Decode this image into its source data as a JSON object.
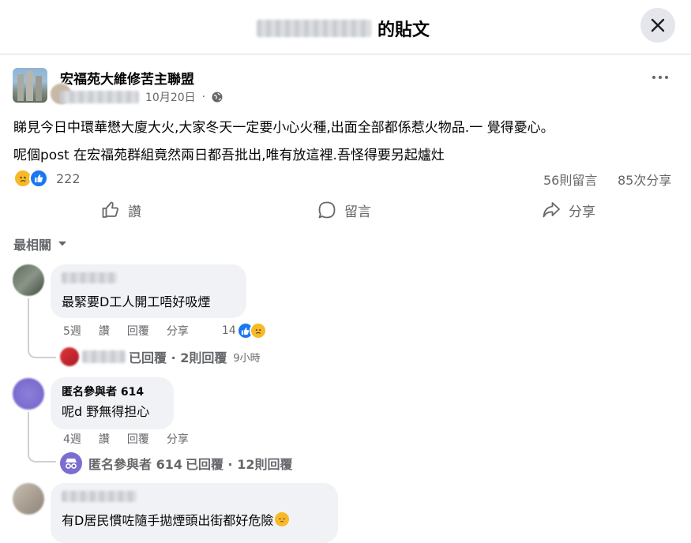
{
  "header": {
    "title_suffix": "的貼文"
  },
  "post": {
    "page_name": "宏福苑大維修苦主聯盟",
    "date": "10月20日",
    "line1": "睇見今日中環華懋大廈大火,大家冬天一定要小心火種,出面全部都係惹火物品.一 覺得憂心。",
    "line2": "呢個post 在宏福苑群組竟然兩日都吾批出,唯有放這裡.吾怪得要另起爐灶",
    "reaction_count": "222",
    "comments_count": "56則留言",
    "shares_count": "85次分享"
  },
  "actions": {
    "like": "讚",
    "comment": "留言",
    "share": "分享"
  },
  "sort_label": "最相關",
  "comments": [
    {
      "text": "最緊要D工人開工唔好吸煙",
      "time": "5週",
      "like": "讚",
      "reply": "回覆",
      "share": "分享",
      "reactions": "14",
      "reply_summary": "已回覆 · 2則回覆",
      "reply_time": "9小時"
    },
    {
      "name": "匿名參與者 614",
      "text": "呢d 野無得担心",
      "time": "4週",
      "like": "讚",
      "reply": "回覆",
      "share": "分享",
      "reply_name": "匿名參與者 614",
      "reply_summary": "已回覆 · 12則回覆"
    },
    {
      "text": "有D居民慣咗隨手拋煙頭出街都好危險"
    }
  ],
  "colors": {
    "accent": "#1877f2",
    "secondary_text": "#65676b",
    "bubble": "#f0f2f5"
  }
}
